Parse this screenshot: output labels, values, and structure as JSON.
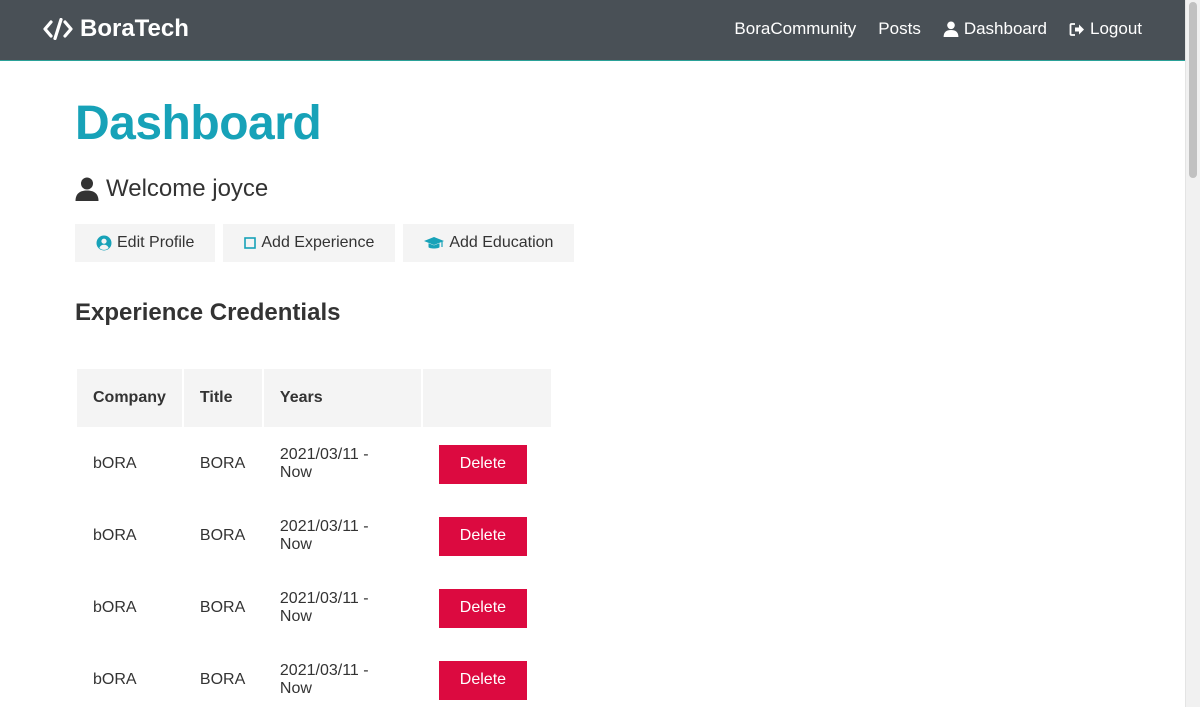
{
  "navbar": {
    "brand": "BoraTech",
    "links": [
      {
        "label": "BoraCommunity",
        "icon": null
      },
      {
        "label": "Posts",
        "icon": null
      },
      {
        "label": "Dashboard",
        "icon": "user-icon"
      },
      {
        "label": "Logout",
        "icon": "logout-icon"
      }
    ]
  },
  "main": {
    "title": "Dashboard",
    "welcome": "Welcome joyce",
    "actions": [
      {
        "label": "Edit Profile",
        "icon": "user-circle-icon"
      },
      {
        "label": "Add Experience",
        "icon": "square-icon"
      },
      {
        "label": "Add Education",
        "icon": "graduation-cap-icon"
      }
    ],
    "experience": {
      "title": "Experience Credentials",
      "headers": [
        "Company",
        "Title",
        "Years",
        ""
      ],
      "rows": [
        {
          "company": "bORA",
          "title": "BORA",
          "years": "2021/03/11 - Now",
          "action": "Delete"
        },
        {
          "company": "bORA",
          "title": "BORA",
          "years": "2021/03/11 - Now",
          "action": "Delete"
        },
        {
          "company": "bORA",
          "title": "BORA",
          "years": "2021/03/11 - Now",
          "action": "Delete"
        },
        {
          "company": "bORA",
          "title": "BORA",
          "years": "2021/03/11 - Now",
          "action": "Delete"
        }
      ]
    }
  },
  "colors": {
    "navbar": "#495056",
    "primary": "#17a2b8",
    "danger": "#dc0a40",
    "light": "#f4f4f4"
  }
}
